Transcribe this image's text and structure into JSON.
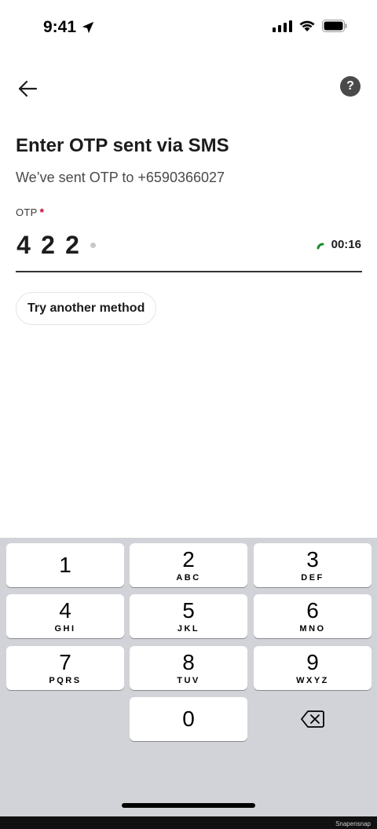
{
  "status_bar": {
    "time": "9:41"
  },
  "header": {
    "back_icon": "arrow-left-icon",
    "help_label": "?"
  },
  "title": "Enter OTP sent via SMS",
  "subtitle": "We’ve sent OTP to +6590366027",
  "otp": {
    "label": "OTP",
    "required_mark": "*",
    "digits": [
      "4",
      "2",
      "2"
    ],
    "timer": "00:16"
  },
  "try_another_method": "Try another method",
  "keypad": {
    "keys": [
      {
        "num": "1",
        "letters": ""
      },
      {
        "num": "2",
        "letters": "ABC"
      },
      {
        "num": "3",
        "letters": "DEF"
      },
      {
        "num": "4",
        "letters": "GHI"
      },
      {
        "num": "5",
        "letters": "JKL"
      },
      {
        "num": "6",
        "letters": "MNO"
      },
      {
        "num": "7",
        "letters": "PQRS"
      },
      {
        "num": "8",
        "letters": "TUV"
      },
      {
        "num": "9",
        "letters": "WXYZ"
      },
      {
        "num": "0",
        "letters": ""
      }
    ],
    "delete_icon": "backspace-icon"
  },
  "colors": {
    "required": "#c0002a",
    "timer_ring": "#1a8a2e",
    "keyboard_bg": "#d1d3d9"
  },
  "watermark": "Snapensnap"
}
